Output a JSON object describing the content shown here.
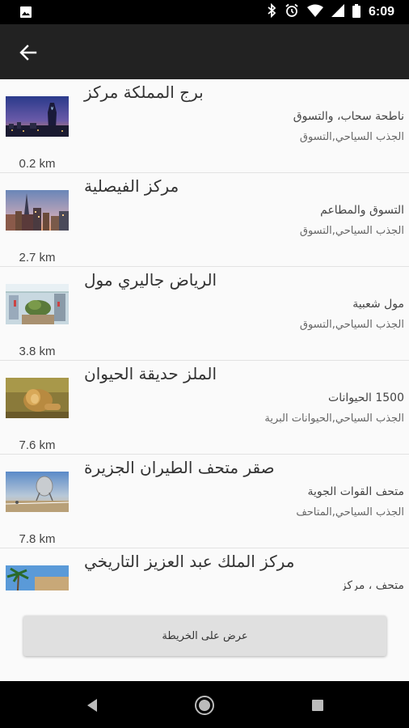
{
  "status_bar": {
    "time": "6:09",
    "icons": [
      "image-notification-icon",
      "bluetooth-icon",
      "alarm-icon",
      "wifi-icon",
      "signal-icon",
      "battery-icon"
    ]
  },
  "app_bar": {
    "back_icon": "arrow-back-icon"
  },
  "places": [
    {
      "title": "برج المملكة مركز",
      "subtitle": "ناطحة سحاب، والتسوق",
      "category": "الجذب السياحي,التسوق",
      "distance": "0.2 km",
      "thumb": "kingdom-tower-night"
    },
    {
      "title": "مركز الفيصلية",
      "subtitle": "التسوق والمطاعم",
      "category": "الجذب السياحي,التسوق",
      "distance": "2.7 km",
      "thumb": "faisaliah-skyline"
    },
    {
      "title": "الرياض جاليري مول",
      "subtitle": "مول شعبية",
      "category": "الجذب السياحي,التسوق",
      "distance": "3.8 km",
      "thumb": "mall-interior"
    },
    {
      "title": "الملز حديقة الحيوان",
      "subtitle": "1500 الحيوانات",
      "category": "الجذب السياحي,الحيوانات البرية",
      "distance": "7.6 km",
      "thumb": "lion"
    },
    {
      "title": "صقر متحف الطيران الجزيرة",
      "subtitle": "متحف القوات الجوية",
      "category": "الجذب السياحي,المتاحف",
      "distance": "7.8 km",
      "thumb": "aviation-museum"
    },
    {
      "title": "مركز الملك عبد العزيز التاريخي",
      "subtitle": "متحف ، مركز",
      "category": "",
      "distance": "",
      "thumb": "palm-building"
    }
  ],
  "footer": {
    "map_button_label": "عرض على الخريطة"
  },
  "nav_bar": {
    "icons": [
      "back-triangle-icon",
      "home-circle-icon",
      "recents-square-icon"
    ]
  }
}
